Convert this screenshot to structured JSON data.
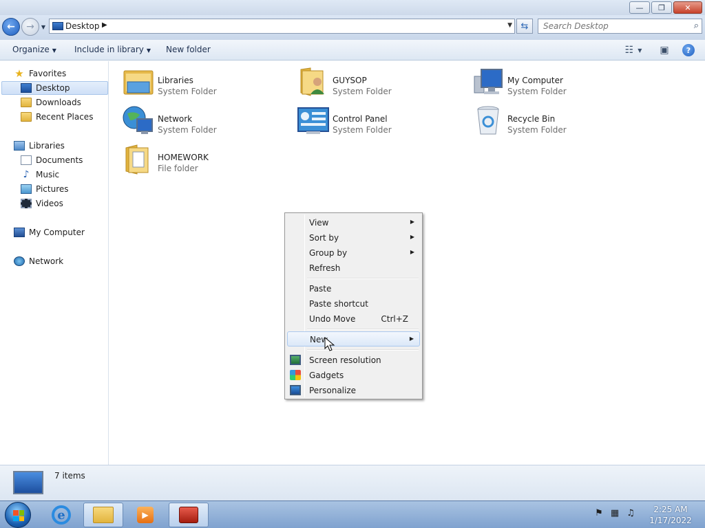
{
  "window": {
    "controls": {
      "minimize": "—",
      "maximize": "❐",
      "close": "✕"
    }
  },
  "address": {
    "location": "Desktop",
    "search_placeholder": "Search Desktop"
  },
  "toolbar": {
    "organize": "Organize",
    "include_in_library": "Include in library",
    "new_folder": "New folder"
  },
  "nav": {
    "favorites": "Favorites",
    "desktop": "Desktop",
    "downloads": "Downloads",
    "recent_places": "Recent Places",
    "libraries": "Libraries",
    "documents": "Documents",
    "music": "Music",
    "pictures": "Pictures",
    "videos": "Videos",
    "my_computer": "My Computer",
    "network": "Network"
  },
  "items": [
    {
      "name": "Libraries",
      "type": "System Folder",
      "icon": "libraries-icon"
    },
    {
      "name": "GUYSOP",
      "type": "System Folder",
      "icon": "user-folder-icon"
    },
    {
      "name": "My Computer",
      "type": "System Folder",
      "icon": "computer-icon"
    },
    {
      "name": "Network",
      "type": "System Folder",
      "icon": "network-icon"
    },
    {
      "name": "Control Panel",
      "type": "System Folder",
      "icon": "control-panel-icon"
    },
    {
      "name": "Recycle Bin",
      "type": "System Folder",
      "icon": "recycle-bin-icon"
    },
    {
      "name": "HOMEWORK",
      "type": "File folder",
      "icon": "folder-icon"
    }
  ],
  "status": {
    "count": "7 items"
  },
  "context_menu": {
    "view": "View",
    "sort_by": "Sort by",
    "group_by": "Group by",
    "refresh": "Refresh",
    "paste": "Paste",
    "paste_shortcut": "Paste shortcut",
    "undo_move": "Undo Move",
    "undo_shortcut": "Ctrl+Z",
    "new": "New",
    "screen_resolution": "Screen resolution",
    "gadgets": "Gadgets",
    "personalize": "Personalize"
  },
  "taskbar": {
    "time": "2:25 AM",
    "date": "1/17/2022"
  }
}
